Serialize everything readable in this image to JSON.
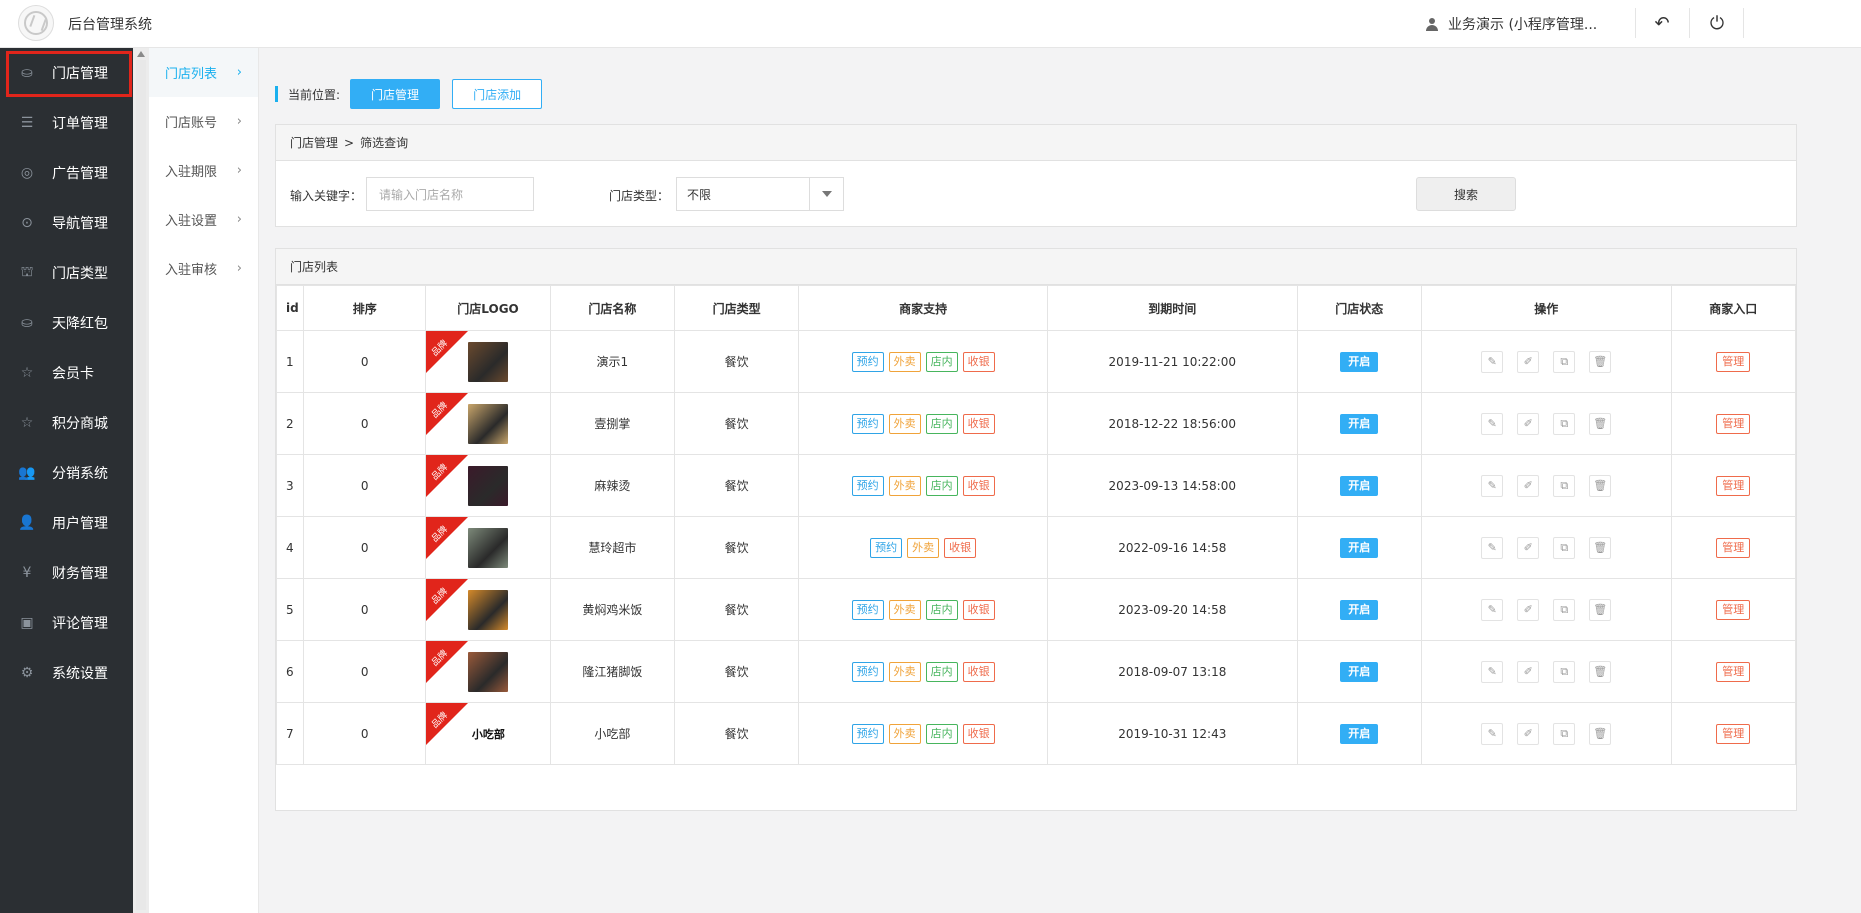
{
  "app": {
    "title": "后台管理系统"
  },
  "header": {
    "user_label": "业务演示 (小程序管理...",
    "back_icon": "undo-icon",
    "power_icon": "power-icon"
  },
  "sidebar": {
    "items": [
      {
        "label": "门店管理",
        "icon": "store-icon",
        "glyph": "⛀"
      },
      {
        "label": "订单管理",
        "icon": "list-icon",
        "glyph": "☰"
      },
      {
        "label": "广告管理",
        "icon": "lifebuoy-icon",
        "glyph": "◎"
      },
      {
        "label": "导航管理",
        "icon": "compass-icon",
        "glyph": "⊙"
      },
      {
        "label": "门店类型",
        "icon": "bank-icon",
        "glyph": "⛫"
      },
      {
        "label": "天降红包",
        "icon": "coins-icon",
        "glyph": "⛀"
      },
      {
        "label": "会员卡",
        "icon": "star-icon",
        "glyph": "☆"
      },
      {
        "label": "积分商城",
        "icon": "star-half-icon",
        "glyph": "☆"
      },
      {
        "label": "分销系统",
        "icon": "users-icon",
        "glyph": "👥"
      },
      {
        "label": "用户管理",
        "icon": "user-icon",
        "glyph": "👤"
      },
      {
        "label": "财务管理",
        "icon": "yen-icon",
        "glyph": "¥"
      },
      {
        "label": "评论管理",
        "icon": "money-icon",
        "glyph": "▣"
      },
      {
        "label": "系统设置",
        "icon": "gear-icon",
        "glyph": "⚙"
      }
    ]
  },
  "subnav": {
    "items": [
      {
        "label": "门店列表"
      },
      {
        "label": "门店账号"
      },
      {
        "label": "入驻期限"
      },
      {
        "label": "入驻设置"
      },
      {
        "label": "入驻审核"
      }
    ]
  },
  "breadcrumb": {
    "label": "当前位置:",
    "current": "门店管理",
    "add": "门店添加"
  },
  "filter": {
    "head": "门店管理",
    "head_sep": ">",
    "head_sub": "筛选查询",
    "keyword_label": "输入关键字：",
    "keyword_placeholder": "请输入门店名称",
    "type_label": "门店类型：",
    "type_value": "不限",
    "search_label": "搜索"
  },
  "list": {
    "title": "门店列表",
    "columns": [
      "id",
      "排序",
      "门店LOGO",
      "门店名称",
      "门店类型",
      "商家支持",
      "到期时间",
      "门店状态",
      "操作",
      "商家入口"
    ],
    "ribbon": "品牌",
    "rows": [
      {
        "id": "1",
        "sort": "0",
        "name": "演示1",
        "type": "餐饮",
        "tags": [
          "预约",
          "外卖",
          "店内",
          "收银"
        ],
        "expire": "2019-11-21 10:22:00",
        "status": "开启",
        "entry": "管理",
        "thumb": "#6b4a2e"
      },
      {
        "id": "2",
        "sort": "0",
        "name": "壹捌掌",
        "type": "餐饮",
        "tags": [
          "预约",
          "外卖",
          "店内",
          "收银"
        ],
        "expire": "2018-12-22 18:56:00",
        "status": "开启",
        "entry": "管理",
        "thumb": "#c9a66b"
      },
      {
        "id": "3",
        "sort": "0",
        "name": "麻辣烫",
        "type": "餐饮",
        "tags": [
          "预约",
          "外卖",
          "店内",
          "收银"
        ],
        "expire": "2023-09-13 14:58:00",
        "status": "开启",
        "entry": "管理",
        "thumb": "#3b1a2a"
      },
      {
        "id": "4",
        "sort": "0",
        "name": "慧玲超市",
        "type": "餐饮",
        "tags": [
          "预约",
          "外卖",
          "收银"
        ],
        "expire": "2022-09-16 14:58",
        "status": "开启",
        "entry": "管理",
        "thumb": "#7d8a7a"
      },
      {
        "id": "5",
        "sort": "0",
        "name": "黄焖鸡米饭",
        "type": "餐饮",
        "tags": [
          "预约",
          "外卖",
          "店内",
          "收银"
        ],
        "expire": "2023-09-20 14:58",
        "status": "开启",
        "entry": "管理",
        "thumb": "#d58a2a"
      },
      {
        "id": "6",
        "sort": "0",
        "name": "隆江猪脚饭",
        "type": "餐饮",
        "tags": [
          "预约",
          "外卖",
          "店内",
          "收银"
        ],
        "expire": "2018-09-07 13:18",
        "status": "开启",
        "entry": "管理",
        "thumb": "#9a5a3a"
      },
      {
        "id": "7",
        "sort": "0",
        "name": "小吃部",
        "type": "餐饮",
        "tags": [
          "预约",
          "外卖",
          "店内",
          "收银"
        ],
        "expire": "2019-10-31 12:43",
        "status": "开启",
        "entry": "管理",
        "thumb": "text",
        "thumb_text": "小吃部"
      }
    ],
    "ops": [
      {
        "icon": "pencil-icon",
        "glyph": "✎"
      },
      {
        "icon": "edit-icon",
        "glyph": "✐"
      },
      {
        "icon": "copy-icon",
        "glyph": "⧉"
      },
      {
        "icon": "trash-icon",
        "glyph": "🗑"
      }
    ]
  },
  "colors": {
    "accent": "#32aef5",
    "sidebar": "#2b2f33",
    "danger": "#e1251b"
  }
}
